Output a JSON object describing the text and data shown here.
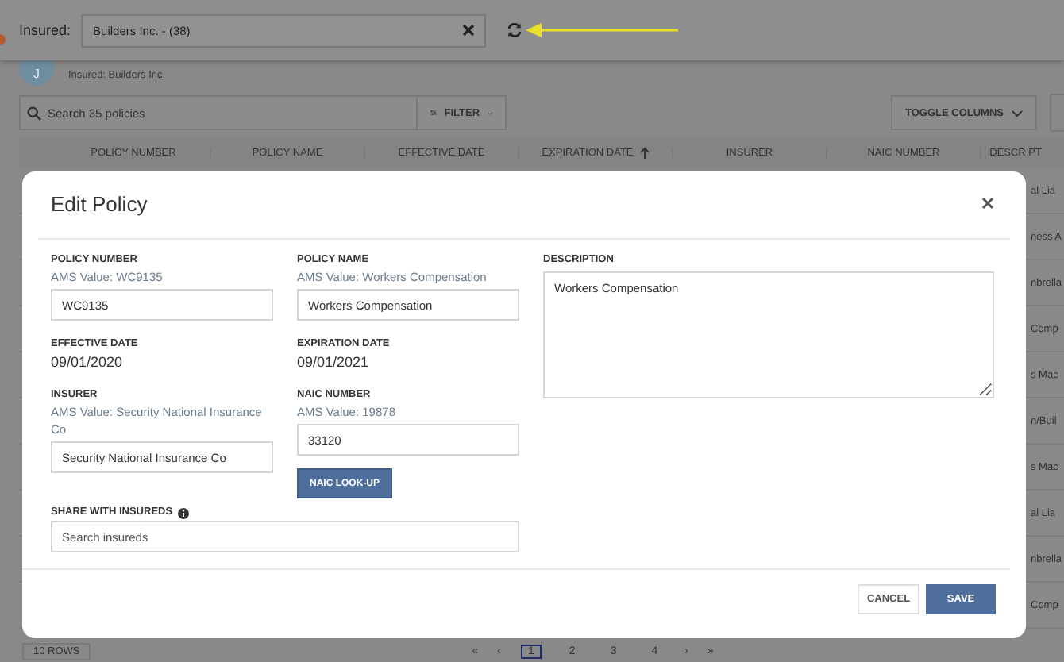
{
  "header": {
    "label": "Insured:",
    "insured_field": {
      "value": "Builders Inc. - (38)"
    }
  },
  "account": {
    "avatar_initial": "J",
    "subtitle": "Insured: Builders Inc."
  },
  "toolbar": {
    "search": {
      "placeholder": "Search 35 policies"
    },
    "filter_button": "FILTER",
    "toggle_columns_button": "TOGGLE COLUMNS"
  },
  "table": {
    "columns": [
      {
        "label": "POLICY NUMBER",
        "sorted": false
      },
      {
        "label": "POLICY NAME",
        "sorted": false
      },
      {
        "label": "EFFECTIVE DATE",
        "sorted": false
      },
      {
        "label": "EXPIRATION DATE",
        "sorted": true
      },
      {
        "label": "INSURER",
        "sorted": false
      },
      {
        "label": "NAIC NUMBER",
        "sorted": false
      },
      {
        "label": "DESCRIPT",
        "sorted": false
      }
    ],
    "rows": [
      {
        "column_7": "al Lia"
      },
      {
        "column_7": "ness A"
      },
      {
        "column_7": "nbrella"
      },
      {
        "column_7": "Comp"
      },
      {
        "column_7": "s Mac"
      },
      {
        "column_7": "n/Buil"
      },
      {
        "column_7": "s Mac"
      },
      {
        "column_7": "al Lia"
      },
      {
        "column_7": "nbrella"
      },
      {
        "column_7": "Comp"
      }
    ]
  },
  "pagination": {
    "rows_per_page": "10 ROWS",
    "before": [
      "«",
      "‹"
    ],
    "pages": [
      {
        "label": "1",
        "selected": true
      },
      {
        "label": "2",
        "selected": false
      },
      {
        "label": "3",
        "selected": false
      },
      {
        "label": "4",
        "selected": false
      }
    ],
    "after": [
      "›",
      "»"
    ]
  },
  "modal": {
    "title": "Edit Policy",
    "fields": [
      {
        "kind": "input",
        "label": "POLICY NUMBER",
        "ams_value": "AMS Value: WC9135",
        "value": "WC9135"
      },
      {
        "kind": "input",
        "label": "POLICY NAME",
        "ams_value": "AMS Value: Workers Compensation",
        "value": "Workers Compensation"
      },
      {
        "kind": "static",
        "label": "EFFECTIVE DATE",
        "value": "09/01/2020"
      },
      {
        "kind": "static",
        "label": "EXPIRATION DATE",
        "value": "09/01/2021"
      },
      {
        "kind": "input",
        "label": "INSURER",
        "ams_value": "AMS Value: Security National Insurance Co",
        "value": "Security National Insurance Co"
      },
      {
        "kind": "input",
        "label": "NAIC NUMBER",
        "ams_value": "AMS Value: 19878",
        "value": "33120",
        "button": "NAIC LOOK-UP"
      }
    ],
    "share": {
      "label": "SHARE WITH INSUREDS",
      "placeholder": "Search insureds"
    },
    "description": {
      "label": "DESCRIPTION",
      "value": "Workers Compensation"
    },
    "buttons": [
      {
        "kind": "secondary",
        "label": "CANCEL"
      },
      {
        "kind": "primary",
        "label": "SAVE"
      }
    ]
  }
}
